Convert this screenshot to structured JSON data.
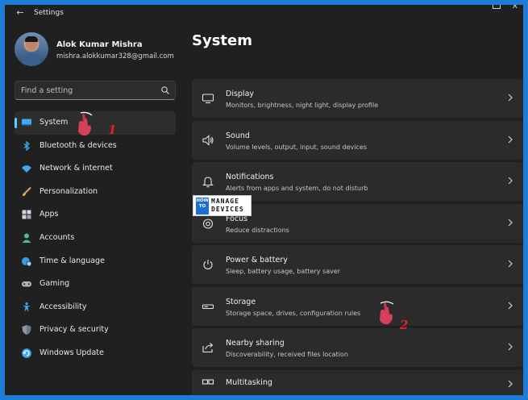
{
  "window": {
    "title": "Settings"
  },
  "profile": {
    "name": "Alok Kumar Mishra",
    "email": "mishra.alokkumar328@gmail.com"
  },
  "search": {
    "placeholder": "Find a setting"
  },
  "nav": {
    "items": [
      {
        "label": "System",
        "icon": "monitor-icon",
        "active": true
      },
      {
        "label": "Bluetooth & devices",
        "icon": "bluetooth-icon"
      },
      {
        "label": "Network & internet",
        "icon": "wifi-icon"
      },
      {
        "label": "Personalization",
        "icon": "brush-icon"
      },
      {
        "label": "Apps",
        "icon": "apps-icon"
      },
      {
        "label": "Accounts",
        "icon": "person-icon"
      },
      {
        "label": "Time & language",
        "icon": "globe-clock-icon"
      },
      {
        "label": "Gaming",
        "icon": "gamepad-icon"
      },
      {
        "label": "Accessibility",
        "icon": "accessibility-icon"
      },
      {
        "label": "Privacy & security",
        "icon": "shield-icon"
      },
      {
        "label": "Windows Update",
        "icon": "update-icon"
      }
    ]
  },
  "page": {
    "title": "System"
  },
  "cards": [
    {
      "title": "Display",
      "subtitle": "Monitors, brightness, night light, display profile",
      "icon": "display-icon"
    },
    {
      "title": "Sound",
      "subtitle": "Volume levels, output, input, sound devices",
      "icon": "speaker-icon"
    },
    {
      "title": "Notifications",
      "subtitle": "Alerts from apps and system, do not disturb",
      "icon": "bell-icon"
    },
    {
      "title": "Focus",
      "subtitle": "Reduce distractions",
      "icon": "focus-icon"
    },
    {
      "title": "Power & battery",
      "subtitle": "Sleep, battery usage, battery saver",
      "icon": "power-icon"
    },
    {
      "title": "Storage",
      "subtitle": "Storage space, drives, configuration rules",
      "icon": "storage-icon"
    },
    {
      "title": "Nearby sharing",
      "subtitle": "Discoverability, received files location",
      "icon": "share-icon"
    },
    {
      "title": "Multitasking",
      "subtitle": "",
      "icon": "multitasking-icon"
    }
  ],
  "watermark": {
    "how": "HOW TO",
    "line1": "MANAGE",
    "line2": "DEVICES"
  },
  "annotations": {
    "step1": "1",
    "step2": "2"
  },
  "colors": {
    "accent": "#60cdff",
    "frame": "#1e7bd6",
    "annotation": "#e2232a"
  }
}
